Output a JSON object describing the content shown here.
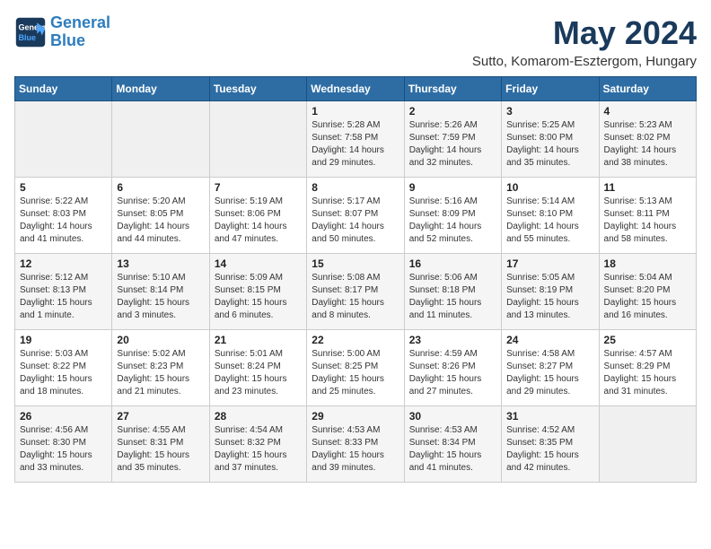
{
  "logo": {
    "line1": "General",
    "line2": "Blue"
  },
  "title": "May 2024",
  "subtitle": "Sutto, Komarom-Esztergom, Hungary",
  "weekdays": [
    "Sunday",
    "Monday",
    "Tuesday",
    "Wednesday",
    "Thursday",
    "Friday",
    "Saturday"
  ],
  "weeks": [
    [
      null,
      null,
      null,
      {
        "day": "1",
        "sunrise": "Sunrise: 5:28 AM",
        "sunset": "Sunset: 7:58 PM",
        "daylight": "Daylight: 14 hours and 29 minutes."
      },
      {
        "day": "2",
        "sunrise": "Sunrise: 5:26 AM",
        "sunset": "Sunset: 7:59 PM",
        "daylight": "Daylight: 14 hours and 32 minutes."
      },
      {
        "day": "3",
        "sunrise": "Sunrise: 5:25 AM",
        "sunset": "Sunset: 8:00 PM",
        "daylight": "Daylight: 14 hours and 35 minutes."
      },
      {
        "day": "4",
        "sunrise": "Sunrise: 5:23 AM",
        "sunset": "Sunset: 8:02 PM",
        "daylight": "Daylight: 14 hours and 38 minutes."
      }
    ],
    [
      {
        "day": "5",
        "sunrise": "Sunrise: 5:22 AM",
        "sunset": "Sunset: 8:03 PM",
        "daylight": "Daylight: 14 hours and 41 minutes."
      },
      {
        "day": "6",
        "sunrise": "Sunrise: 5:20 AM",
        "sunset": "Sunset: 8:05 PM",
        "daylight": "Daylight: 14 hours and 44 minutes."
      },
      {
        "day": "7",
        "sunrise": "Sunrise: 5:19 AM",
        "sunset": "Sunset: 8:06 PM",
        "daylight": "Daylight: 14 hours and 47 minutes."
      },
      {
        "day": "8",
        "sunrise": "Sunrise: 5:17 AM",
        "sunset": "Sunset: 8:07 PM",
        "daylight": "Daylight: 14 hours and 50 minutes."
      },
      {
        "day": "9",
        "sunrise": "Sunrise: 5:16 AM",
        "sunset": "Sunset: 8:09 PM",
        "daylight": "Daylight: 14 hours and 52 minutes."
      },
      {
        "day": "10",
        "sunrise": "Sunrise: 5:14 AM",
        "sunset": "Sunset: 8:10 PM",
        "daylight": "Daylight: 14 hours and 55 minutes."
      },
      {
        "day": "11",
        "sunrise": "Sunrise: 5:13 AM",
        "sunset": "Sunset: 8:11 PM",
        "daylight": "Daylight: 14 hours and 58 minutes."
      }
    ],
    [
      {
        "day": "12",
        "sunrise": "Sunrise: 5:12 AM",
        "sunset": "Sunset: 8:13 PM",
        "daylight": "Daylight: 15 hours and 1 minute."
      },
      {
        "day": "13",
        "sunrise": "Sunrise: 5:10 AM",
        "sunset": "Sunset: 8:14 PM",
        "daylight": "Daylight: 15 hours and 3 minutes."
      },
      {
        "day": "14",
        "sunrise": "Sunrise: 5:09 AM",
        "sunset": "Sunset: 8:15 PM",
        "daylight": "Daylight: 15 hours and 6 minutes."
      },
      {
        "day": "15",
        "sunrise": "Sunrise: 5:08 AM",
        "sunset": "Sunset: 8:17 PM",
        "daylight": "Daylight: 15 hours and 8 minutes."
      },
      {
        "day": "16",
        "sunrise": "Sunrise: 5:06 AM",
        "sunset": "Sunset: 8:18 PM",
        "daylight": "Daylight: 15 hours and 11 minutes."
      },
      {
        "day": "17",
        "sunrise": "Sunrise: 5:05 AM",
        "sunset": "Sunset: 8:19 PM",
        "daylight": "Daylight: 15 hours and 13 minutes."
      },
      {
        "day": "18",
        "sunrise": "Sunrise: 5:04 AM",
        "sunset": "Sunset: 8:20 PM",
        "daylight": "Daylight: 15 hours and 16 minutes."
      }
    ],
    [
      {
        "day": "19",
        "sunrise": "Sunrise: 5:03 AM",
        "sunset": "Sunset: 8:22 PM",
        "daylight": "Daylight: 15 hours and 18 minutes."
      },
      {
        "day": "20",
        "sunrise": "Sunrise: 5:02 AM",
        "sunset": "Sunset: 8:23 PM",
        "daylight": "Daylight: 15 hours and 21 minutes."
      },
      {
        "day": "21",
        "sunrise": "Sunrise: 5:01 AM",
        "sunset": "Sunset: 8:24 PM",
        "daylight": "Daylight: 15 hours and 23 minutes."
      },
      {
        "day": "22",
        "sunrise": "Sunrise: 5:00 AM",
        "sunset": "Sunset: 8:25 PM",
        "daylight": "Daylight: 15 hours and 25 minutes."
      },
      {
        "day": "23",
        "sunrise": "Sunrise: 4:59 AM",
        "sunset": "Sunset: 8:26 PM",
        "daylight": "Daylight: 15 hours and 27 minutes."
      },
      {
        "day": "24",
        "sunrise": "Sunrise: 4:58 AM",
        "sunset": "Sunset: 8:27 PM",
        "daylight": "Daylight: 15 hours and 29 minutes."
      },
      {
        "day": "25",
        "sunrise": "Sunrise: 4:57 AM",
        "sunset": "Sunset: 8:29 PM",
        "daylight": "Daylight: 15 hours and 31 minutes."
      }
    ],
    [
      {
        "day": "26",
        "sunrise": "Sunrise: 4:56 AM",
        "sunset": "Sunset: 8:30 PM",
        "daylight": "Daylight: 15 hours and 33 minutes."
      },
      {
        "day": "27",
        "sunrise": "Sunrise: 4:55 AM",
        "sunset": "Sunset: 8:31 PM",
        "daylight": "Daylight: 15 hours and 35 minutes."
      },
      {
        "day": "28",
        "sunrise": "Sunrise: 4:54 AM",
        "sunset": "Sunset: 8:32 PM",
        "daylight": "Daylight: 15 hours and 37 minutes."
      },
      {
        "day": "29",
        "sunrise": "Sunrise: 4:53 AM",
        "sunset": "Sunset: 8:33 PM",
        "daylight": "Daylight: 15 hours and 39 minutes."
      },
      {
        "day": "30",
        "sunrise": "Sunrise: 4:53 AM",
        "sunset": "Sunset: 8:34 PM",
        "daylight": "Daylight: 15 hours and 41 minutes."
      },
      {
        "day": "31",
        "sunrise": "Sunrise: 4:52 AM",
        "sunset": "Sunset: 8:35 PM",
        "daylight": "Daylight: 15 hours and 42 minutes."
      },
      null
    ]
  ]
}
